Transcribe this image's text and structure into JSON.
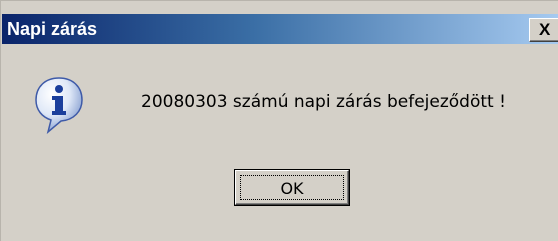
{
  "window": {
    "title": "Napi zárás",
    "close_glyph": "X"
  },
  "message": {
    "text": "20080303 számú napi zárás befejeződött !",
    "icon": "info-icon"
  },
  "buttons": {
    "ok_label": "OK"
  },
  "colors": {
    "titlebar_start": "#0a246a",
    "titlebar_end": "#a6caf0",
    "dialog_face": "#d4d0c8"
  }
}
